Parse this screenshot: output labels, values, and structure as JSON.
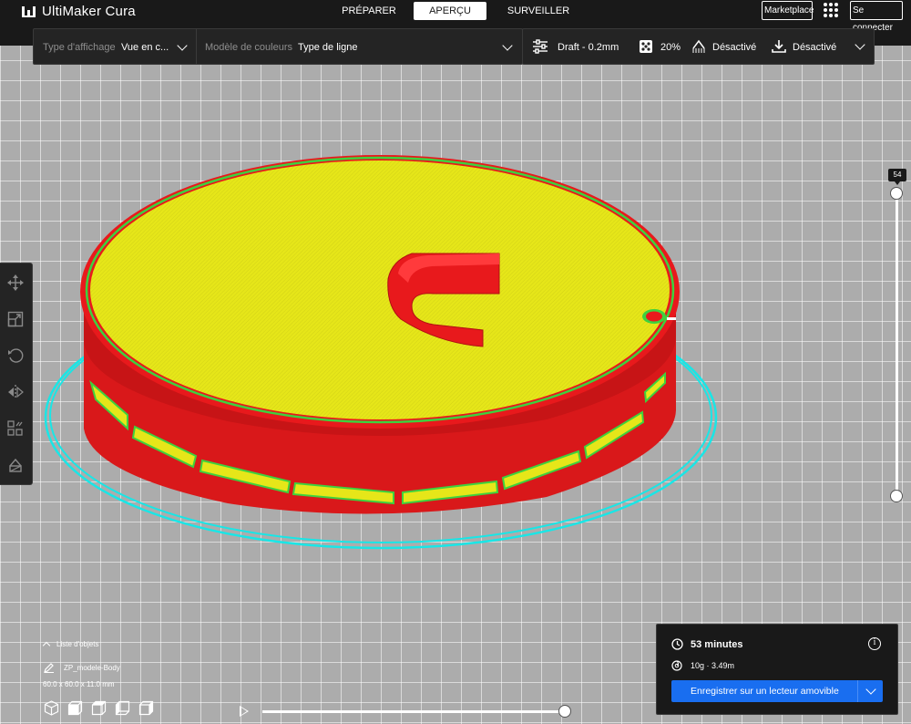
{
  "app": {
    "name": "UltiMaker Cura",
    "logo_icon": "ultimaker-logo-icon"
  },
  "stages": {
    "prepare": "PRÉPARER",
    "preview": "APERÇU",
    "monitor": "SURVEILLER",
    "active": "preview"
  },
  "header": {
    "marketplace": "Marketplace",
    "signin": "Se connecter",
    "apps_icon": "apps-grid-icon"
  },
  "view_options": {
    "view_type_label": "Type d'affichage",
    "view_type_value": "Vue en c...",
    "color_scheme_label": "Modèle de couleurs",
    "color_scheme_value": "Type de ligne"
  },
  "print_setup": {
    "profile": "Draft - 0.2mm",
    "infill": "20%",
    "support": "Désactivé",
    "adhesion": "Désactivé"
  },
  "tools": [
    {
      "name": "move-tool",
      "icon": "move-icon"
    },
    {
      "name": "scale-tool",
      "icon": "scale-icon"
    },
    {
      "name": "rotate-tool",
      "icon": "rotate-icon"
    },
    {
      "name": "mirror-tool",
      "icon": "mirror-icon"
    },
    {
      "name": "per-model-settings-tool",
      "icon": "per-model-settings-icon"
    },
    {
      "name": "support-blocker-tool",
      "icon": "support-blocker-icon"
    }
  ],
  "layer_slider": {
    "current_layer": "54"
  },
  "object_list": {
    "toggle_label": "Liste d'objets",
    "object_name": "ZP_modele-Body",
    "dimensions": "60.0 x 60.0 x 11.0 mm"
  },
  "camera_views": [
    "3d-view-icon",
    "front-view-icon",
    "top-view-icon",
    "left-view-icon",
    "right-view-icon"
  ],
  "simulation": {
    "play_icon": "play-icon",
    "progress": 1.0
  },
  "print_info": {
    "time": "53 minutes",
    "material": "10g · 3.49m",
    "save_button": "Enregistrer sur un lecteur amovible"
  },
  "colors": {
    "accent": "#196ef0",
    "topbar": "#191919",
    "panel": "#242424",
    "wall_red": "#e8191c",
    "infill_yellow": "#e6e619",
    "inner_green": "#3ed13e",
    "skirt_cyan": "#19e6e6"
  }
}
